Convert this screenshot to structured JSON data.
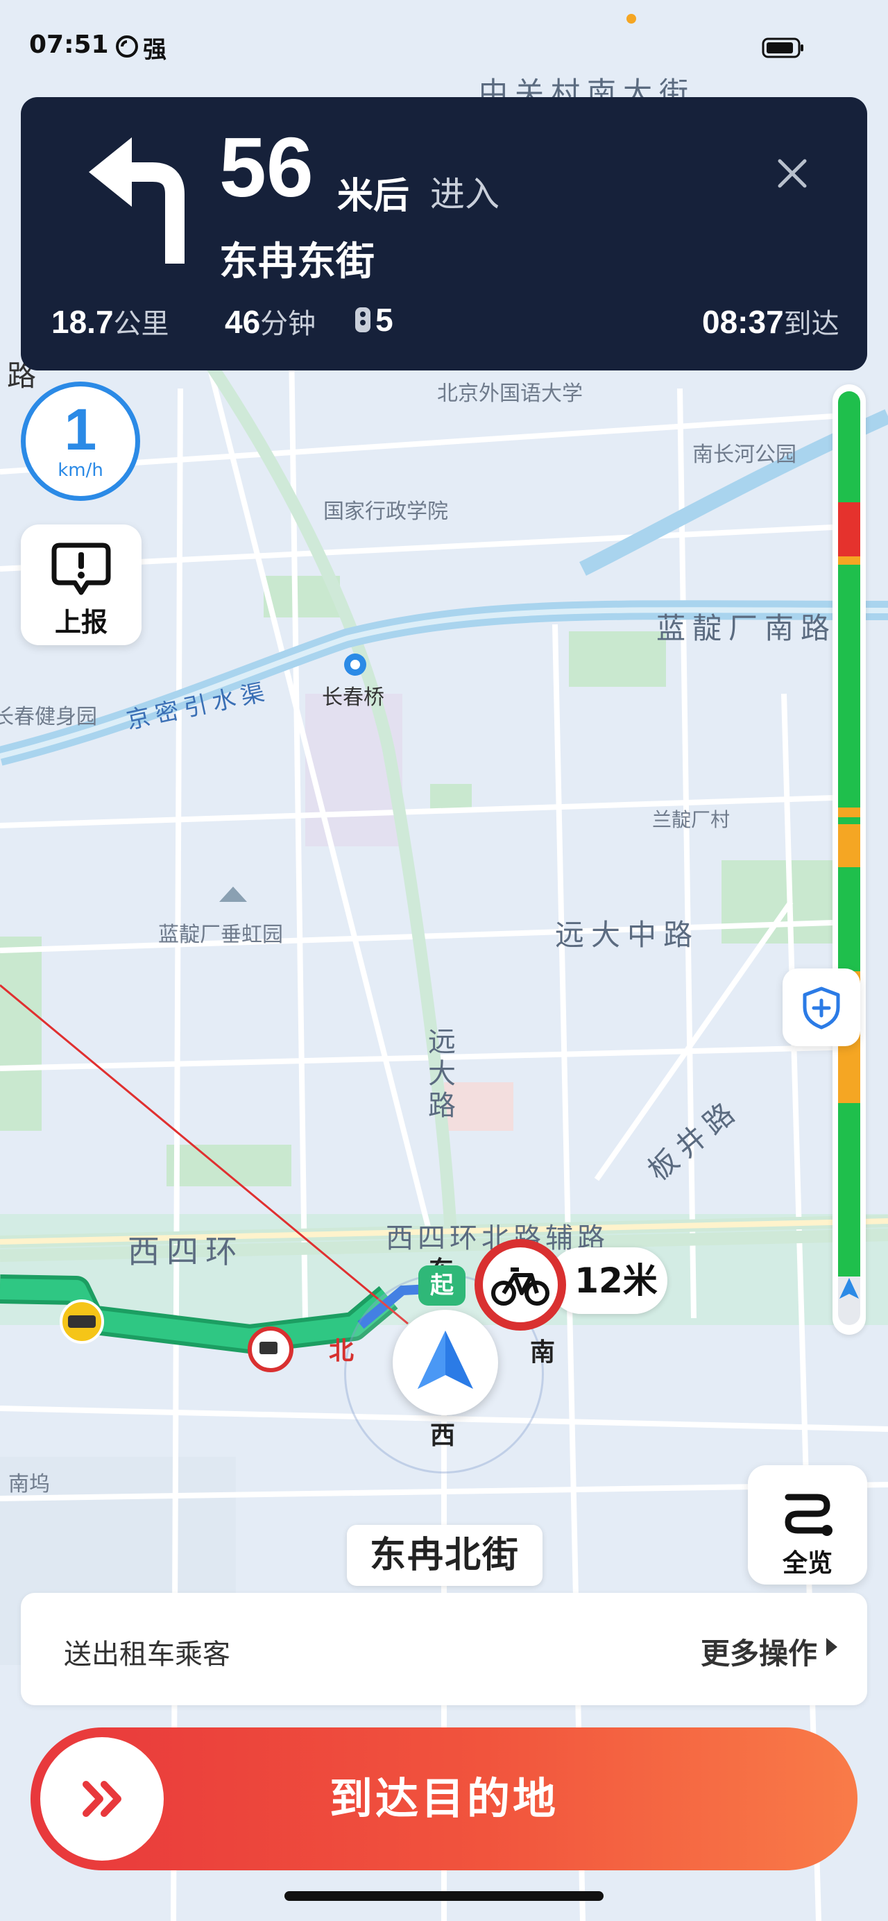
{
  "status_bar": {
    "time": "07:51",
    "signal": "强"
  },
  "navigation": {
    "distance": "56",
    "distance_unit": "米后",
    "action": "进入",
    "next_road": "东冉东街",
    "remaining_distance": "18.7",
    "remaining_distance_unit": "公里",
    "remaining_time": "46",
    "remaining_time_unit": "分钟",
    "traffic_lights": "5",
    "arrival_time": "08:37",
    "arrival_label": "到达"
  },
  "speed": {
    "value": "1",
    "unit": "km/h"
  },
  "report_button": {
    "label": "上报"
  },
  "overview_button": {
    "label": "全览"
  },
  "current_road": "东冉北街",
  "map": {
    "labels": {
      "zhongguancun": "中关村南大街",
      "bfsu": "北京外国语大学",
      "nanchanghe": "南长河公园",
      "naea": "国家行政学院",
      "landianchang_south": "蓝靛厂南路",
      "jingmi": "京密引水渠",
      "changchunqiao": "长春桥",
      "changchun_gym": "长春健身园",
      "landianchang_village": "兰靛厂村",
      "chuihong": "蓝靛厂垂虹园",
      "yuanda_zhong": "远大中路",
      "yuanda": "远大路",
      "banjing": "板井路",
      "xisihuan": "西四环",
      "xisihuan_fulu": "西四环北路辅路",
      "nanwu": "南坞",
      "lu_left": "路",
      "start_marker": "起"
    },
    "compass": {
      "north": "北",
      "east": "东",
      "south": "南",
      "west": "西"
    },
    "bike_lane_distance": "12米"
  },
  "traffic_bar": {
    "colors": {
      "green": "#1fbf4c",
      "red": "#e5322d",
      "orange": "#f5a623"
    }
  },
  "action_bar": {
    "left_label": "送出租车乘客",
    "right_label": "更多操作"
  },
  "arrive_button": {
    "label": "到达目的地"
  },
  "colors": {
    "nav_card": "#16213a",
    "accent_blue": "#2b8ae6",
    "arrive_red": "#e8383c",
    "route_green": "#2fc783"
  }
}
